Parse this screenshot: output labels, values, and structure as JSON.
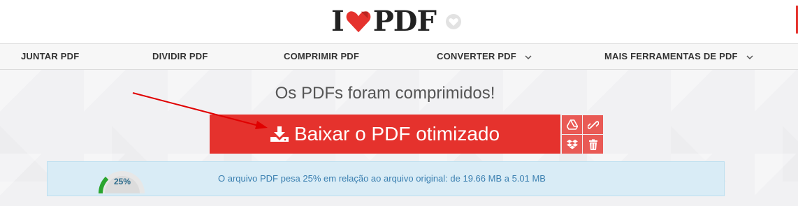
{
  "header": {
    "logo": {
      "left": "I",
      "right": "PDF",
      "brand_color": "#e5322d"
    },
    "language_icon": "heart-globe-icon"
  },
  "nav": {
    "items": [
      {
        "label": "JUNTAR PDF",
        "has_dropdown": false
      },
      {
        "label": "DIVIDIR PDF",
        "has_dropdown": false
      },
      {
        "label": "COMPRIMIR PDF",
        "has_dropdown": false
      },
      {
        "label": "CONVERTER PDF",
        "has_dropdown": true
      },
      {
        "label": "MAIS FERRAMENTAS DE PDF",
        "has_dropdown": true
      }
    ]
  },
  "main": {
    "title": "Os PDFs foram comprimidos!",
    "download_button": {
      "label": "Baixar o PDF otimizado",
      "icon": "download-icon"
    },
    "side_actions": [
      {
        "name": "google-drive",
        "icon": "google-drive-icon"
      },
      {
        "name": "share-link",
        "icon": "link-icon"
      },
      {
        "name": "dropbox",
        "icon": "dropbox-icon"
      },
      {
        "name": "delete",
        "icon": "trash-icon"
      }
    ],
    "result": {
      "percent_label": "25%",
      "percent_value": 25,
      "message": "O arquivo PDF pesa 25% em relação ao arquivo original: de 19.66 MB a 5.01 MB"
    }
  },
  "colors": {
    "accent": "#e5322d",
    "side_button": "#e95a55",
    "info_bg": "#d9ecf6",
    "info_text": "#3a7fb0",
    "gauge_fill": "#2aa52f"
  }
}
